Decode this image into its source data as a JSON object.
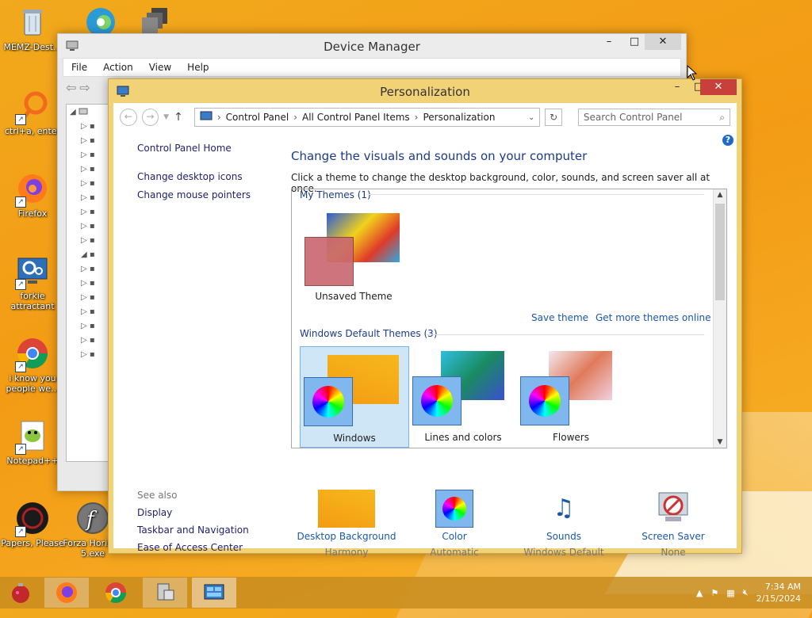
{
  "desktop": {
    "icons": [
      {
        "label": "MEMZ-Dest...",
        "icon": "recycle-bin-icon"
      },
      {
        "label": "ctrl+a, enter",
        "icon": "loop-icon"
      },
      {
        "label": "Firefox",
        "icon": "firefox-icon"
      },
      {
        "label": "forkie attractant",
        "icon": "settings-monitor-icon"
      },
      {
        "label": "i know you people we...",
        "icon": "chrome-icon"
      },
      {
        "label": "Notepad++",
        "icon": "notepadpp-icon"
      },
      {
        "label": "Papers, Please",
        "icon": "papers-please-icon"
      },
      {
        "label": "Forza Horizon 5.exe",
        "icon": "flash-icon"
      }
    ]
  },
  "device_manager": {
    "title": "Device Manager",
    "menu": [
      "File",
      "Action",
      "View",
      "Help"
    ]
  },
  "personalization": {
    "title": "Personalization",
    "breadcrumb": [
      "Control Panel",
      "All Control Panel Items",
      "Personalization"
    ],
    "search_placeholder": "Search Control Panel",
    "left_nav": {
      "home": "Control Panel Home",
      "items": [
        "Change desktop icons",
        "Change mouse pointers"
      ]
    },
    "see_also": {
      "header": "See also",
      "items": [
        "Display",
        "Taskbar and Navigation",
        "Ease of Access Center"
      ]
    },
    "heading": "Change the visuals and sounds on your computer",
    "subheading": "Click a theme to change the desktop background, color, sounds, and screen saver all at once.",
    "my_themes": {
      "header": "My Themes (1)",
      "items": [
        {
          "label": "Unsaved Theme"
        }
      ]
    },
    "links": {
      "save": "Save theme",
      "more": "Get more themes online"
    },
    "default_themes": {
      "header": "Windows Default Themes (3)",
      "items": [
        {
          "label": "Windows",
          "selected": true
        },
        {
          "label": "Lines and colors",
          "selected": false
        },
        {
          "label": "Flowers",
          "selected": false
        }
      ]
    },
    "bottom": [
      {
        "caption": "Desktop Background",
        "sub": "Harmony"
      },
      {
        "caption": "Color",
        "sub": "Automatic"
      },
      {
        "caption": "Sounds",
        "sub": "Windows Default"
      },
      {
        "caption": "Screen Saver",
        "sub": "None"
      }
    ]
  },
  "taskbar": {
    "time": "7:34 AM",
    "date": "2/15/2024"
  }
}
